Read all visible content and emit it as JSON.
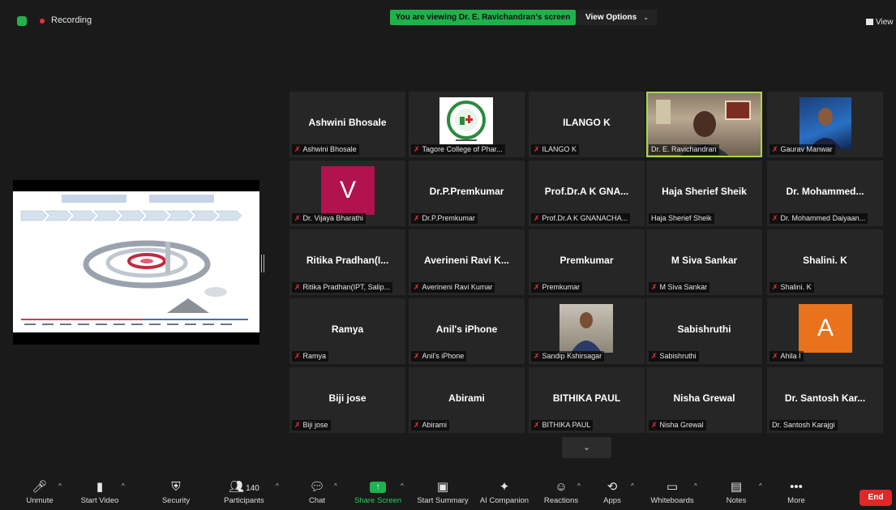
{
  "top": {
    "recording": "Recording",
    "viewing_banner": "You are viewing Dr. E. Ravichandran's screen",
    "view_options": "View Options",
    "view": "View"
  },
  "tiles": [
    {
      "name": "Ashwini Bhosale",
      "label": "Ashwini Bhosale",
      "muted": true
    },
    {
      "name": "",
      "label": "Tagore College of Phar...",
      "muted": true,
      "logo": true
    },
    {
      "name": "ILANGO K",
      "label": "ILANGO K",
      "muted": true
    },
    {
      "name": "",
      "label": "Dr. E. Ravichandran",
      "muted": false,
      "video": true
    },
    {
      "name": "",
      "label": "Gaurav Manwar",
      "muted": true,
      "photo": true
    },
    {
      "name": "",
      "label": "Dr. Vijaya Bharathi",
      "muted": true,
      "letter": "V",
      "letter_color": "#b0134d"
    },
    {
      "name": "Dr.P.Premkumar",
      "label": "Dr.P.Premkumar",
      "muted": true
    },
    {
      "name": "Prof.Dr.A K GNA...",
      "label": "Prof.Dr.A K GNANACHA...",
      "muted": true
    },
    {
      "name": "Haja Sherief Sheik",
      "label": "Haja Sherief Sheik",
      "muted": false
    },
    {
      "name": "Dr.  Mohammed...",
      "label": "Dr. Mohammed Daiyaan...",
      "muted": true
    },
    {
      "name": "Ritika  Pradhan(I...",
      "label": "Ritika Pradhan(IPT, Salip...",
      "muted": true
    },
    {
      "name": "Averineni  Ravi  K...",
      "label": "Averineni Ravi Kumar",
      "muted": true
    },
    {
      "name": "Premkumar",
      "label": "Premkumar",
      "muted": true
    },
    {
      "name": "M Siva Sankar",
      "label": "M Siva Sankar",
      "muted": true
    },
    {
      "name": "Shalini. K",
      "label": "Shalini. K",
      "muted": true
    },
    {
      "name": "Ramya",
      "label": "Ramya",
      "muted": true
    },
    {
      "name": "Anil's iPhone",
      "label": "Anil's iPhone",
      "muted": true
    },
    {
      "name": "",
      "label": "Sandip Kshirsagar",
      "muted": true,
      "photo": true
    },
    {
      "name": "Sabishruthi",
      "label": "Sabishruthi",
      "muted": true
    },
    {
      "name": "",
      "label": "Ahila I",
      "muted": true,
      "letter": "A",
      "letter_color": "#e8731c"
    },
    {
      "name": "Biji jose",
      "label": "Biji jose",
      "muted": true
    },
    {
      "name": "Abirami",
      "label": "Abirami",
      "muted": true
    },
    {
      "name": "BITHIKA PAUL",
      "label": "BITHIKA PAUL",
      "muted": true
    },
    {
      "name": "Nisha Grewal",
      "label": "Nisha Grewal",
      "muted": true
    },
    {
      "name": "Dr. Santosh Kar...",
      "label": "Dr. Santosh Karajgi",
      "muted": false
    }
  ],
  "logo_text": "TAGORE COLLEGE OF PHARMACY",
  "toolbar": {
    "unmute": "Unmute",
    "start_video": "Start Video",
    "security": "Security",
    "participants": "Participants",
    "participant_count": "140",
    "chat": "Chat",
    "share_screen": "Share Screen",
    "start_summary": "Start Summary",
    "ai_companion": "AI Companion",
    "reactions": "Reactions",
    "apps": "Apps",
    "whiteboards": "Whiteboards",
    "notes": "Notes",
    "more": "More",
    "end": "End"
  },
  "colors": {
    "accent_green": "#21b14b",
    "end_red": "#e02828",
    "active_border": "#a7d74a"
  }
}
